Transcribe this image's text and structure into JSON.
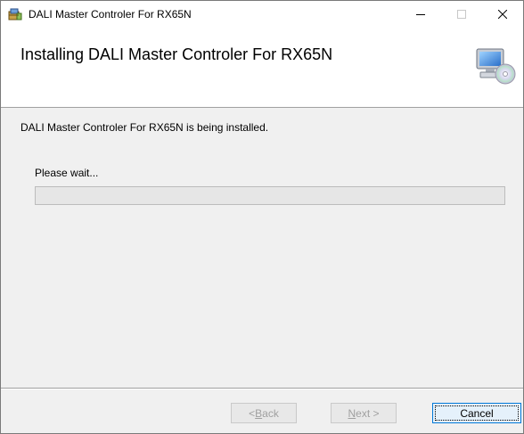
{
  "window": {
    "title": "DALI Master Controler For RX65N",
    "controls": {
      "minimize": "—",
      "maximize": "☐",
      "close": "✕"
    }
  },
  "banner": {
    "heading": "Installing DALI Master Controler For RX65N",
    "icon": "computer-cd-icon"
  },
  "body": {
    "status": "DALI Master Controler For RX65N is being installed.",
    "wait_label": "Please wait...",
    "progress_fraction": 0.0
  },
  "buttons": {
    "back": {
      "prefix": "< ",
      "accel": "B",
      "rest": "ack",
      "enabled": false
    },
    "next": {
      "accel": "N",
      "rest": "ext >",
      "enabled": false
    },
    "cancel": {
      "label": "Cancel",
      "enabled": true
    }
  },
  "colors": {
    "banner_bg": "#ffffff",
    "body_bg": "#f0f0f0",
    "progress_track": "#e6e6e6",
    "focus_border": "#0078d7"
  }
}
